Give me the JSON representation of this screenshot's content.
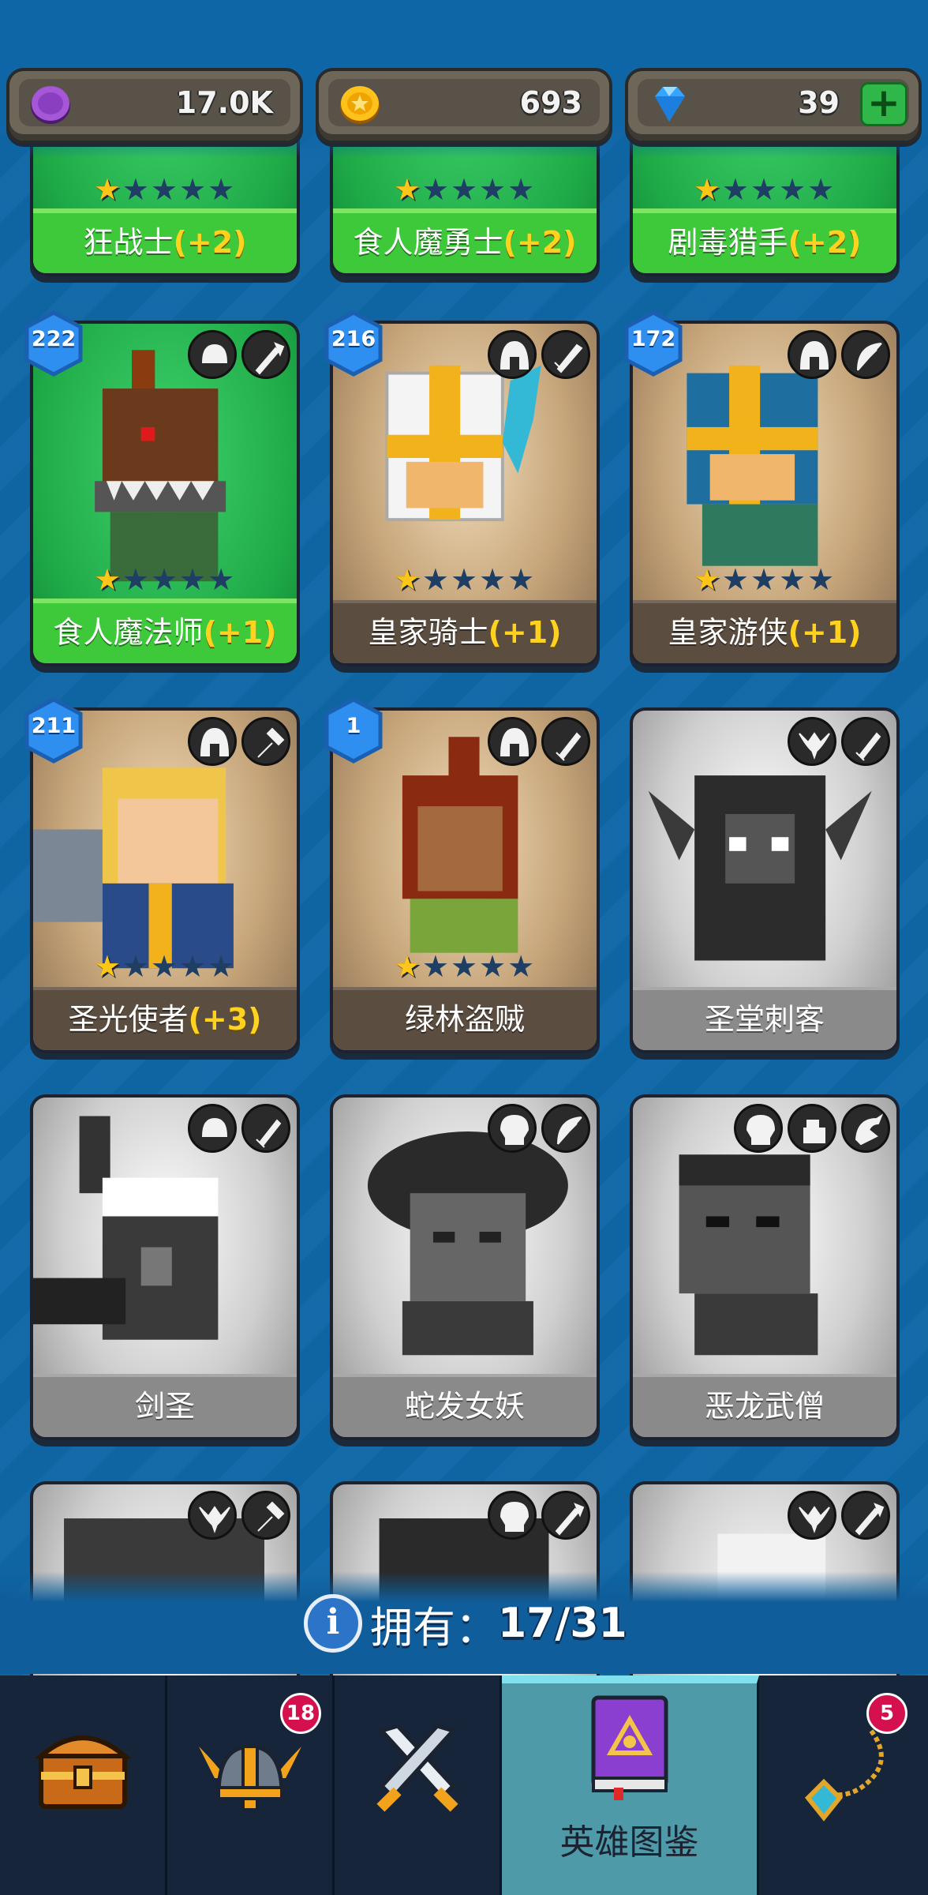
{
  "currencies": {
    "elixir": {
      "value": "17.0K",
      "icon": "purple-coin-icon"
    },
    "gold": {
      "value": "693",
      "icon": "gold-coin-icon"
    },
    "gems": {
      "value": "39",
      "icon": "diamond-icon",
      "add_label": "+"
    }
  },
  "heroes": [
    {
      "name": "狂战士",
      "bonus": "(+2)",
      "stars": 1
    },
    {
      "name": "食人魔勇士",
      "bonus": "(+2)",
      "stars": 1
    },
    {
      "name": "剧毒猎手",
      "bonus": "(+2)",
      "stars": 1
    },
    {
      "name": "食人魔法师",
      "bonus": "(+1)",
      "stars": 1,
      "level": "222",
      "faction_icon": "ogre-icon",
      "weapon_icon": "staff-icon"
    },
    {
      "name": "皇家骑士",
      "bonus": "(+1)",
      "stars": 1,
      "level": "216",
      "faction_icon": "helmet-icon",
      "weapon_icon": "sword-icon"
    },
    {
      "name": "皇家游侠",
      "bonus": "(+1)",
      "stars": 1,
      "level": "172",
      "faction_icon": "helmet-icon",
      "weapon_icon": "bow-icon"
    },
    {
      "name": "圣光使者",
      "bonus": "(+3)",
      "stars": 1,
      "level": "211",
      "faction_icon": "helmet-icon",
      "weapon_icon": "hammer-icon"
    },
    {
      "name": "绿林盗贼",
      "bonus": "",
      "stars": 1,
      "level": "1",
      "faction_icon": "helmet-icon",
      "weapon_icon": "dagger-icon"
    },
    {
      "name": "圣堂刺客",
      "bonus": "",
      "locked": true,
      "faction_icon": "winged-emblem-icon",
      "weapon_icon": "dagger-icon"
    },
    {
      "name": "剑圣",
      "bonus": "",
      "locked": true,
      "faction_icon": "ogre-icon",
      "weapon_icon": "dagger-icon"
    },
    {
      "name": "蛇发女妖",
      "bonus": "",
      "locked": true,
      "faction_icon": "skull-icon",
      "weapon_icon": "bow-icon"
    },
    {
      "name": "恶龙武僧",
      "bonus": "",
      "locked": true,
      "faction_icon": "skull-icon",
      "weapon_icon": "fist-icon",
      "extra_icon": "dragon-icon"
    },
    {
      "name": "",
      "locked": true,
      "faction_icon": "winged-emblem-icon",
      "weapon_icon": "hammer-icon"
    },
    {
      "name": "",
      "locked": true,
      "faction_icon": "skull-icon",
      "weapon_icon": "staff-icon"
    },
    {
      "name": "",
      "locked": true,
      "faction_icon": "winged-emblem-icon",
      "weapon_icon": "staff-icon"
    }
  ],
  "collection": {
    "label": "拥有：",
    "count": "17/31"
  },
  "nav": {
    "tabs": [
      {
        "id": "shop",
        "icon": "treasure-chest-icon"
      },
      {
        "id": "heroes",
        "icon": "viking-helmet-icon",
        "badge": "18"
      },
      {
        "id": "battle",
        "icon": "crossed-swords-icon"
      },
      {
        "id": "collection",
        "icon": "spellbook-icon",
        "label": "英雄图鉴",
        "active": true
      },
      {
        "id": "items",
        "icon": "amulet-icon",
        "badge": "5"
      }
    ]
  }
}
